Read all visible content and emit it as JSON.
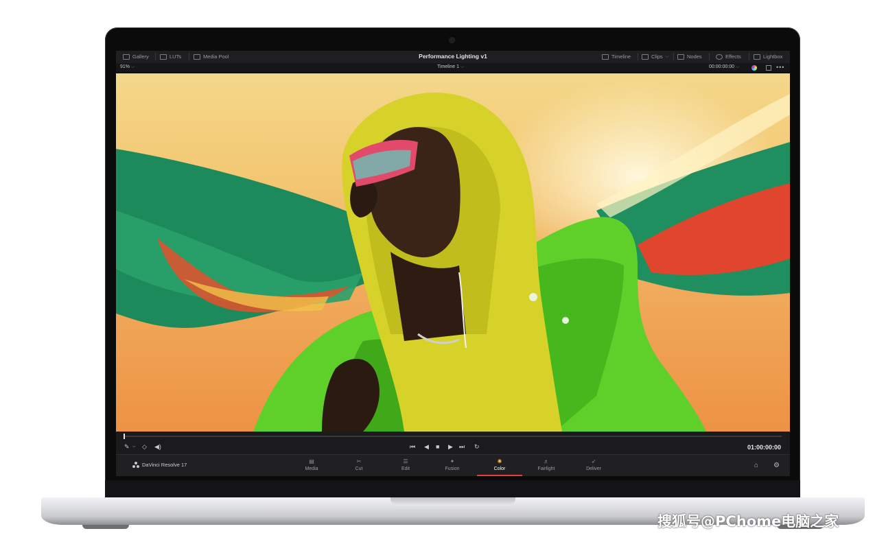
{
  "topbar": {
    "left_items": [
      {
        "label": "Gallery",
        "icon": "gallery-icon"
      },
      {
        "label": "LUTs",
        "icon": "luts-icon"
      },
      {
        "label": "Media Pool",
        "icon": "media-pool-icon"
      }
    ],
    "project_title": "Performance Lighting v1",
    "right_items": [
      {
        "label": "Timeline",
        "icon": "timeline-icon"
      },
      {
        "label": "Clips",
        "icon": "clips-icon"
      },
      {
        "label": "Nodes",
        "icon": "nodes-icon"
      },
      {
        "label": "Effects",
        "icon": "effects-icon"
      },
      {
        "label": "Lightbox",
        "icon": "lightbox-icon"
      }
    ]
  },
  "viewer_bar": {
    "zoom": "91%",
    "timeline_name": "Timeline 1",
    "source_timecode": "00:00:00:00"
  },
  "transport": {
    "timecode": "01:00:00:00",
    "icons": [
      "eyedropper-icon",
      "layers-icon",
      "volume-icon",
      "skip-back-icon",
      "play-reverse-icon",
      "stop-icon",
      "play-icon",
      "skip-forward-icon",
      "loop-icon"
    ]
  },
  "pagebar": {
    "app_name": "DaVinci Resolve 17",
    "pages": [
      {
        "label": "Media",
        "icon": "media-page-icon",
        "active": false
      },
      {
        "label": "Cut",
        "icon": "cut-page-icon",
        "active": false
      },
      {
        "label": "Edit",
        "icon": "edit-page-icon",
        "active": false
      },
      {
        "label": "Fusion",
        "icon": "fusion-page-icon",
        "active": false
      },
      {
        "label": "Color",
        "icon": "color-page-icon",
        "active": true
      },
      {
        "label": "Fairlight",
        "icon": "fairlight-page-icon",
        "active": false
      },
      {
        "label": "Deliver",
        "icon": "deliver-page-icon",
        "active": false
      }
    ]
  },
  "colors": {
    "accent": "#e0423a",
    "ui_background": "#1b1b1e"
  },
  "watermark": "搜狐号@PChome电脑之家"
}
